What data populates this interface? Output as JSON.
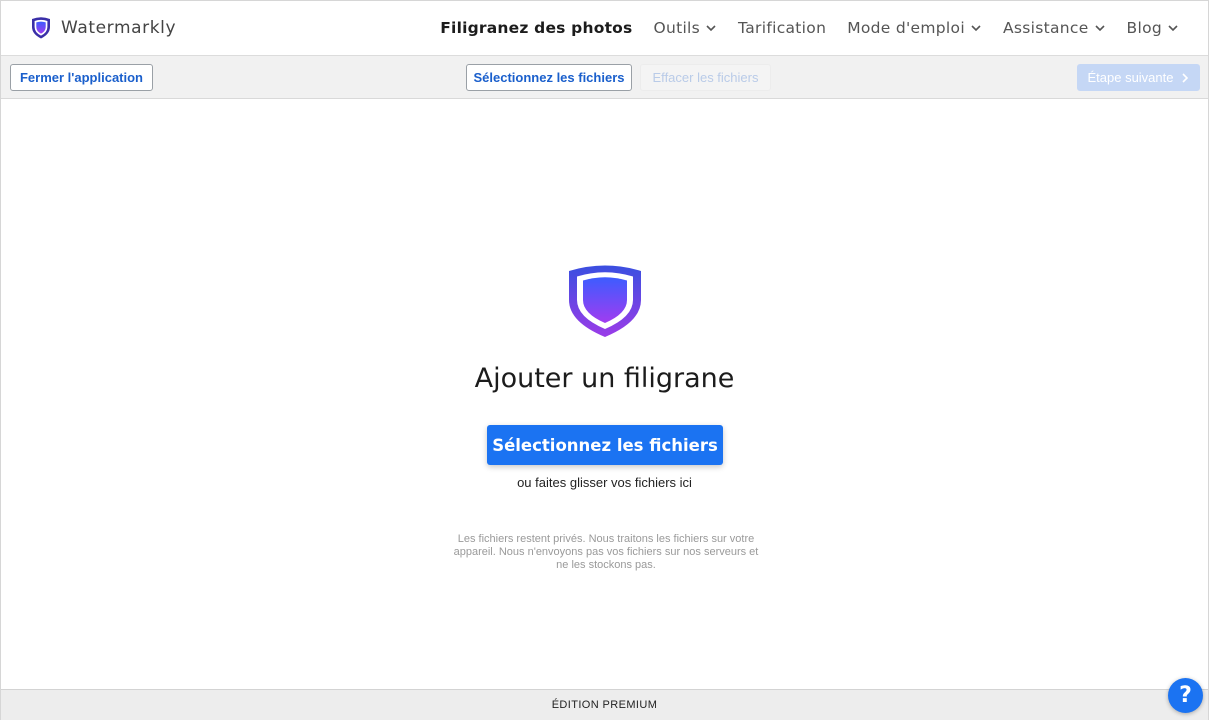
{
  "brand": {
    "name": "Watermarkly",
    "logo_icon": "shield-icon"
  },
  "nav": {
    "items": [
      {
        "label": "Filigranez des photos",
        "active": true,
        "has_dropdown": false
      },
      {
        "label": "Outils",
        "active": false,
        "has_dropdown": true
      },
      {
        "label": "Tarification",
        "active": false,
        "has_dropdown": false
      },
      {
        "label": "Mode d'emploi",
        "active": false,
        "has_dropdown": true
      },
      {
        "label": "Assistance",
        "active": false,
        "has_dropdown": true
      },
      {
        "label": "Blog",
        "active": false,
        "has_dropdown": true
      }
    ]
  },
  "toolbar": {
    "close_label": "Fermer l'application",
    "select_label": "Sélectionnez les fichiers",
    "clear_label": "Effacer les fichiers",
    "next_label": "Étape suivante",
    "clear_disabled": true,
    "next_disabled": true
  },
  "main": {
    "title": "Ajouter un filigrane",
    "cta_label": "Sélectionnez les fichiers",
    "drag_hint": "ou faites glisser vos fichiers ici",
    "privacy_note": "Les fichiers restent privés. Nous traitons les fichiers sur votre appareil. Nous n'envoyons pas vos fichiers sur nos serveurs et ne les stockons pas."
  },
  "footer": {
    "edition": "ÉDITION PREMIUM"
  },
  "help": {
    "label": "?"
  },
  "colors": {
    "accent": "#1b73f2",
    "shield_top": "#3d5cff",
    "shield_bottom": "#a13cf0",
    "shield_border": "#3a2fa8"
  }
}
